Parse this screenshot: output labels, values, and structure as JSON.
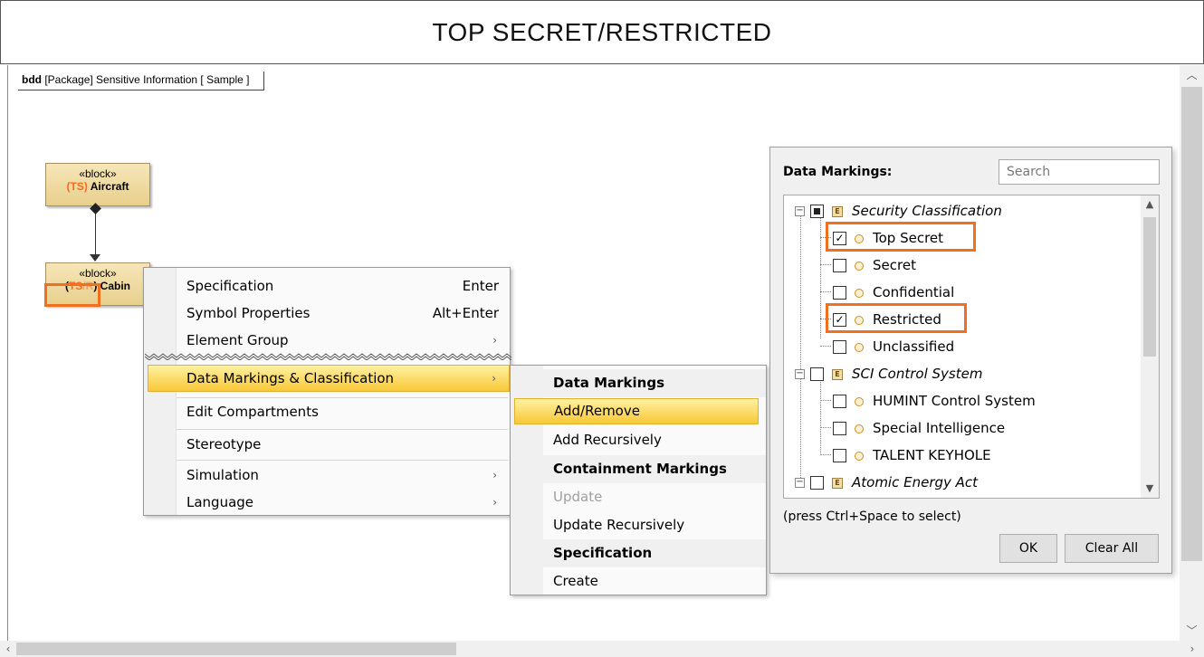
{
  "banner": {
    "text": "TOP SECRET/RESTRICTED"
  },
  "diagram": {
    "frame_kind": "bdd",
    "frame_text": "[Package] Sensitive Information [ Sample ]",
    "blocks": [
      {
        "stereotype": "«block»",
        "prefix_open": "(",
        "mark_ts": "TS",
        "prefix_close": ")",
        "name": "Aircraft"
      },
      {
        "stereotype": "«block»",
        "prefix_open": "(",
        "mark_ts": "TS",
        "slash": "/",
        "mark_r": "R",
        "prefix_close": ")",
        "name": "Cabin"
      }
    ]
  },
  "context_menu": {
    "items": [
      {
        "label": "Specification",
        "shortcut": "Enter"
      },
      {
        "label": "Symbol Properties",
        "shortcut": "Alt+Enter"
      },
      {
        "label": "Element Group",
        "submenu": "›"
      },
      {
        "label": "Data Markings & Classification",
        "submenu": "›"
      },
      {
        "label": "Edit Compartments"
      },
      {
        "label": "Stereotype"
      },
      {
        "label": "Simulation",
        "submenu": "›"
      },
      {
        "label": "Language",
        "submenu": "›"
      }
    ]
  },
  "submenu": {
    "h_data_markings": "Data Markings",
    "add_remove": "Add/Remove",
    "add_recursively": "Add Recursively",
    "h_containment": "Containment Markings",
    "update": "Update",
    "update_recursively": "Update Recursively",
    "h_specification": "Specification",
    "create": "Create"
  },
  "data_markings_panel": {
    "title": "Data Markings:",
    "search_placeholder": "Search",
    "enum_icon": "E",
    "tree": {
      "security_classification": "Security Classification",
      "top_secret": "Top Secret",
      "secret": "Secret",
      "confidential": "Confidential",
      "restricted": "Restricted",
      "unclassified": "Unclassified",
      "sci_control_system": "SCI Control System",
      "humint": "HUMINT Control System",
      "special_intelligence": "Special Intelligence",
      "talent_keyhole": "TALENT KEYHOLE",
      "atomic_energy_act": "Atomic Energy Act"
    },
    "hint": "(press Ctrl+Space to select)",
    "ok_label": "OK",
    "clear_all_label": "Clear All"
  },
  "colors": {
    "marking_ts": "#ff6a1a",
    "highlight": "#f07020",
    "menu_active": "#f8c838"
  }
}
